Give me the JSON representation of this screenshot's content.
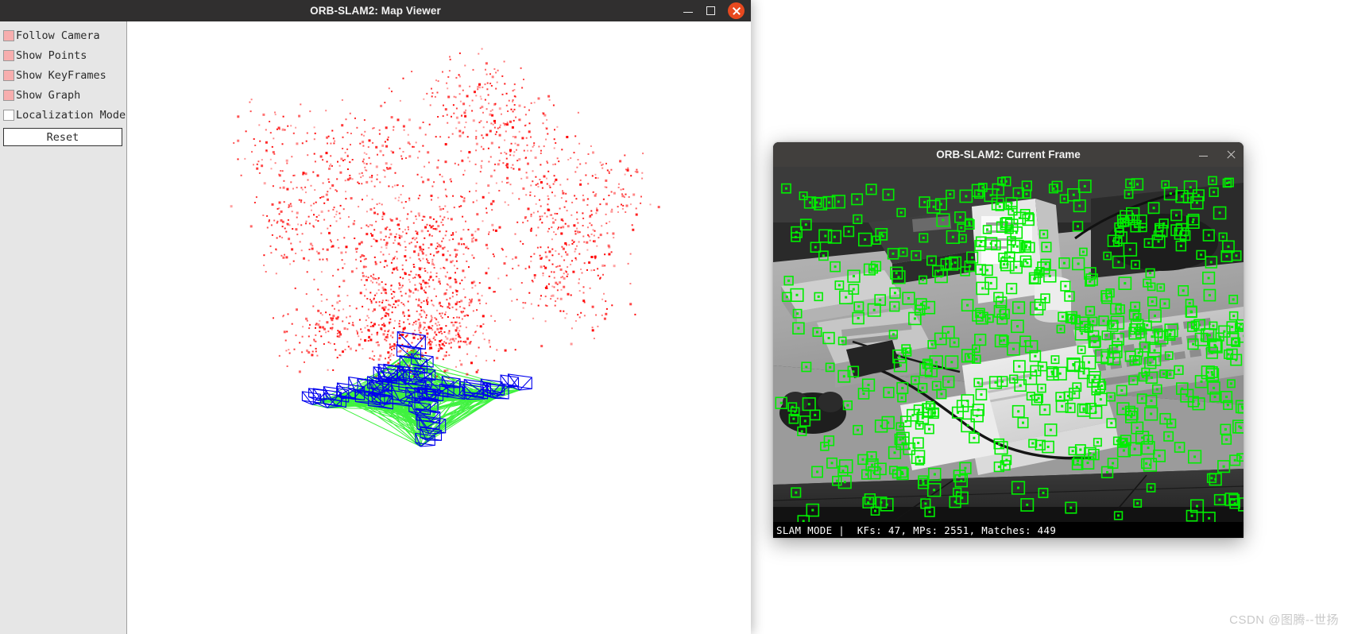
{
  "map_window": {
    "title": "ORB-SLAM2: Map Viewer",
    "controls": {
      "minimize": "minimize",
      "maximize": "maximize",
      "close": "close"
    },
    "sidebar": {
      "checkboxes": [
        {
          "label": "Follow Camera",
          "checked": true
        },
        {
          "label": "Show Points",
          "checked": true
        },
        {
          "label": "Show KeyFrames",
          "checked": true
        },
        {
          "label": "Show Graph",
          "checked": true
        },
        {
          "label": "Localization Mode",
          "checked": false
        }
      ],
      "reset_label": "Reset"
    },
    "viewport": {
      "background_color": "#ffffff",
      "map_point_color": "#ff0000",
      "keyframe_color": "#0000ff",
      "graph_edge_color": "#00ee00"
    }
  },
  "frame_window": {
    "title": "ORB-SLAM2: Current Frame",
    "controls": {
      "minimize": "minimize",
      "close": "close"
    },
    "status": "SLAM MODE |  KFs: 47, MPs: 2551, Matches: 449",
    "status_fields": {
      "mode": "SLAM MODE",
      "keyframes": 47,
      "map_points": 2551,
      "matches": 449
    },
    "feature_color": "#00ee00"
  },
  "watermark": "CSDN @图腾--世扬"
}
